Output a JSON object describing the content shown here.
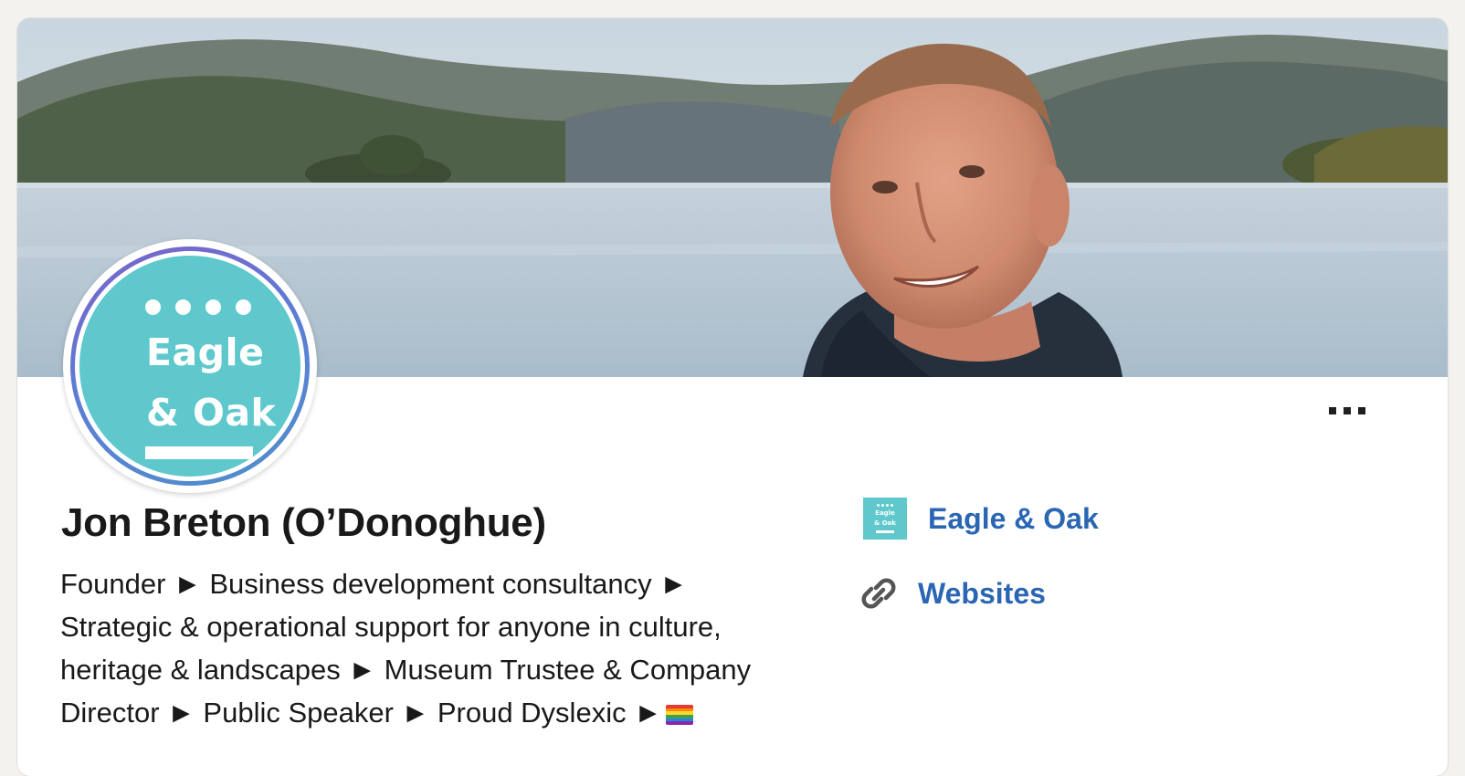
{
  "profile": {
    "name": "Jon Breton (O’Donoghue)",
    "headline_lines": [
      "Founder ► Business development consultancy ►",
      "Strategic & operational support for anyone in culture,",
      "heritage & landscapes ► Museum Trustee & Company",
      "Director ► Public Speaker ► Proud Dyslexic ►"
    ],
    "headline_emoji": "rainbow-flag"
  },
  "avatar": {
    "logo_line1": "Eagle",
    "logo_line2": "& Oak",
    "logo_color": "#5ec8cc"
  },
  "company": {
    "name": "Eagle & Oak",
    "logo_line1": "Eagle",
    "logo_line2": "& Oak"
  },
  "websites": {
    "label": "Websites",
    "icon": "link-chain-icon"
  },
  "more_button": {
    "icon": "more-horizontal-icon"
  },
  "colors": {
    "link": "#2a66b3",
    "text": "#191919",
    "brand_teal": "#5ec8cc"
  }
}
